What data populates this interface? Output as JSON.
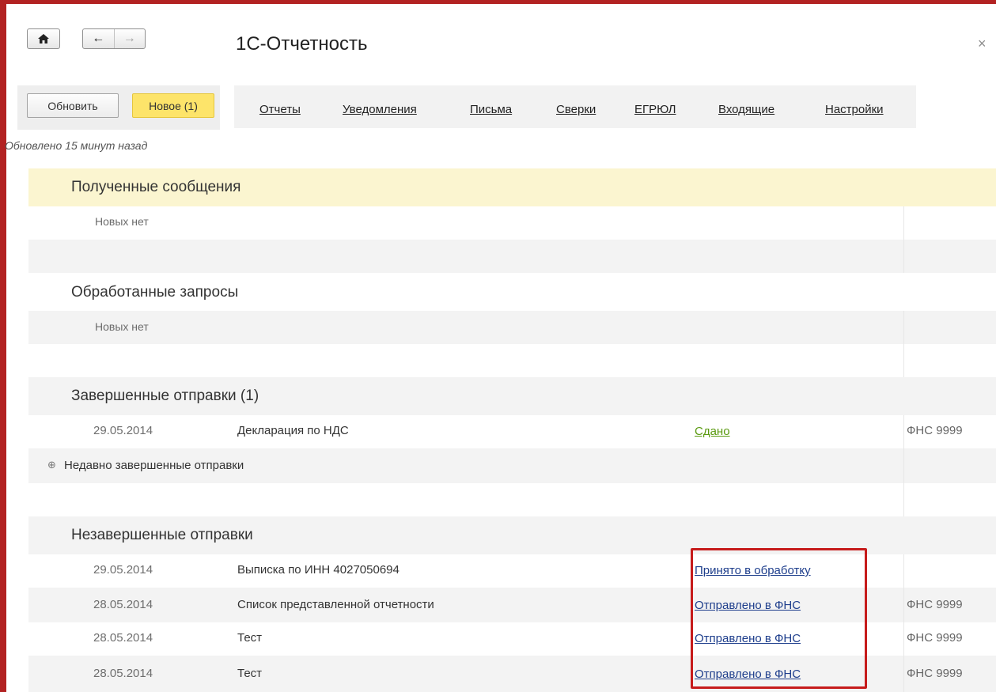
{
  "window": {
    "title": "1С-Отчетность",
    "close_glyph": "×",
    "home_icon": "home-icon",
    "back_glyph": "←",
    "forward_glyph": "→"
  },
  "toolbar": {
    "refresh_label": "Обновить",
    "new_label": "Новое (1)",
    "updated_text": "Обновлено 15 минут назад"
  },
  "tabs": [
    {
      "label": "Отчеты"
    },
    {
      "label": "Уведомления"
    },
    {
      "label": "Письма"
    },
    {
      "label": "Сверки"
    },
    {
      "label": "ЕГРЮЛ"
    },
    {
      "label": "Входящие"
    },
    {
      "label": "Настройки"
    }
  ],
  "received": {
    "title": "Полученные сообщения",
    "note": "Новых нет"
  },
  "processed": {
    "title": "Обработанные запросы",
    "note": "Новых нет"
  },
  "completed": {
    "title": "Завершенные отправки (1)",
    "rows": [
      {
        "date": "29.05.2014",
        "name": "Декларация по НДС",
        "status": "Сдано",
        "org": "ФНС 9999"
      }
    ],
    "recent_label": "Недавно завершенные отправки",
    "expander_glyph": "⊕"
  },
  "incomplete": {
    "title": "Незавершенные отправки",
    "rows": [
      {
        "date": "29.05.2014",
        "name": "Выписка по ИНН 4027050694",
        "status": "Принято в обработку",
        "org": ""
      },
      {
        "date": "28.05.2014",
        "name": "Список представленной отчетности",
        "status": "Отправлено в ФНС",
        "org": "ФНС 9999"
      },
      {
        "date": "28.05.2014",
        "name": "Тест",
        "status": "Отправлено в ФНС",
        "org": "ФНС 9999"
      },
      {
        "date": "28.05.2014",
        "name": "Тест",
        "status": "Отправлено в ФНС",
        "org": "ФНС 9999"
      }
    ]
  },
  "colors": {
    "frame": "#b22222",
    "highlight": "#c61b1b",
    "new_button": "#fde46a",
    "status_done": "#5a9a10",
    "status_link": "#1e3e8c"
  }
}
